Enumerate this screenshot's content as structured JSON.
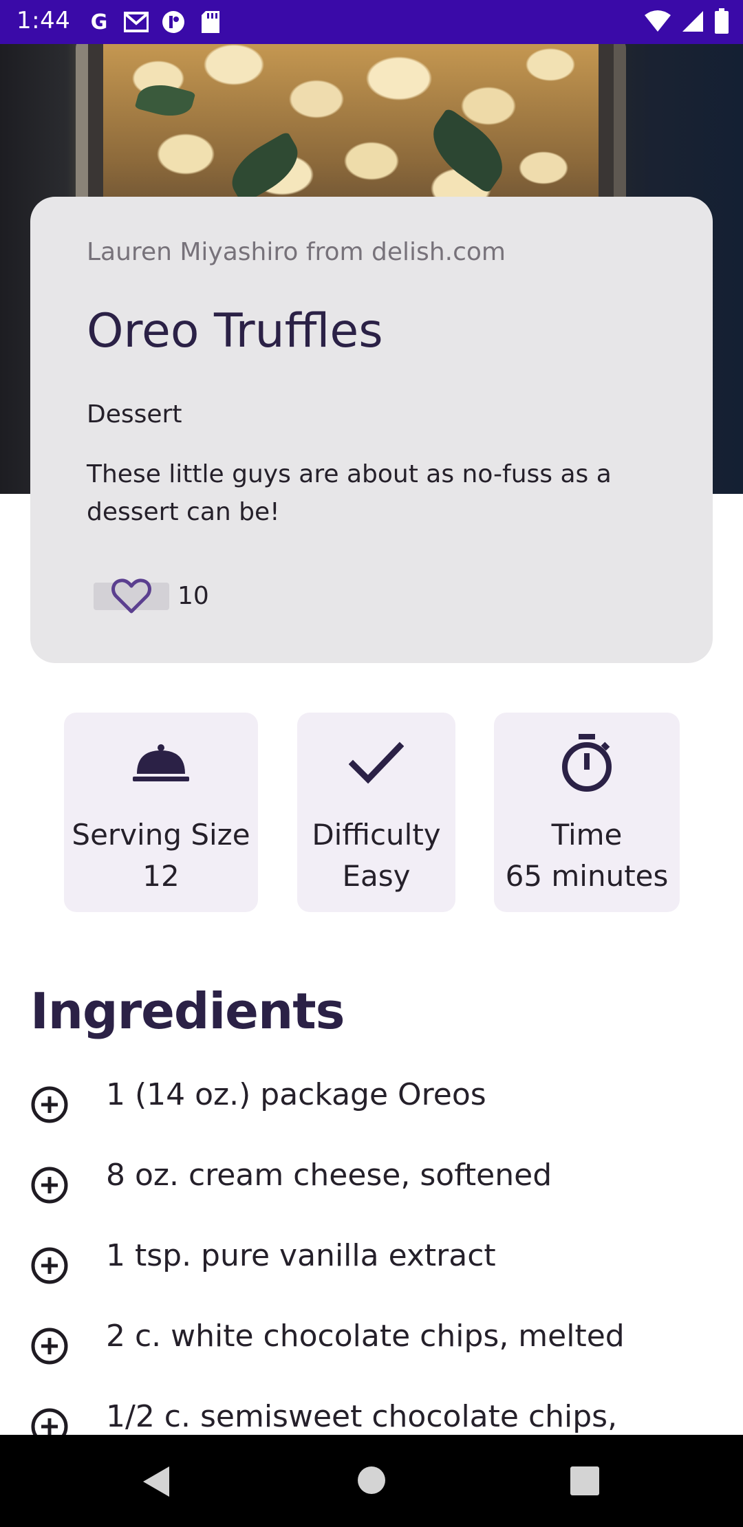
{
  "status_bar": {
    "time": "1:44",
    "left_icons": [
      "google-icon",
      "gmail-icon",
      "app-icon",
      "sd-card-icon"
    ],
    "right_icons": [
      "wifi-icon",
      "signal-icon",
      "battery-icon"
    ],
    "background_color": "#3a0aa8"
  },
  "recipe": {
    "author_line": "Lauren Miyashiro from delish.com",
    "title": "Oreo Truffles",
    "category": "Dessert",
    "description": "These little guys are about as no-fuss as a dessert can be!",
    "likes": "10"
  },
  "stats": {
    "serving": {
      "label": "Serving Size",
      "value": "12",
      "icon": "cloche-icon"
    },
    "difficulty": {
      "label": "Difficulty",
      "value": "Easy",
      "icon": "check-icon"
    },
    "time": {
      "label": "Time",
      "value": "65 minutes",
      "icon": "stopwatch-icon"
    }
  },
  "ingredients": {
    "heading": "Ingredients",
    "items": [
      "1 (14 oz.) package Oreos",
      "8 oz. cream cheese, softened",
      "1 tsp. pure vanilla extract",
      "2 c. white chocolate chips, melted",
      "1/2 c. semisweet chocolate chips,"
    ]
  },
  "colors": {
    "accent": "#2b2146",
    "card_background": "#e7e6e8",
    "tile_background": "#f2eef6"
  }
}
